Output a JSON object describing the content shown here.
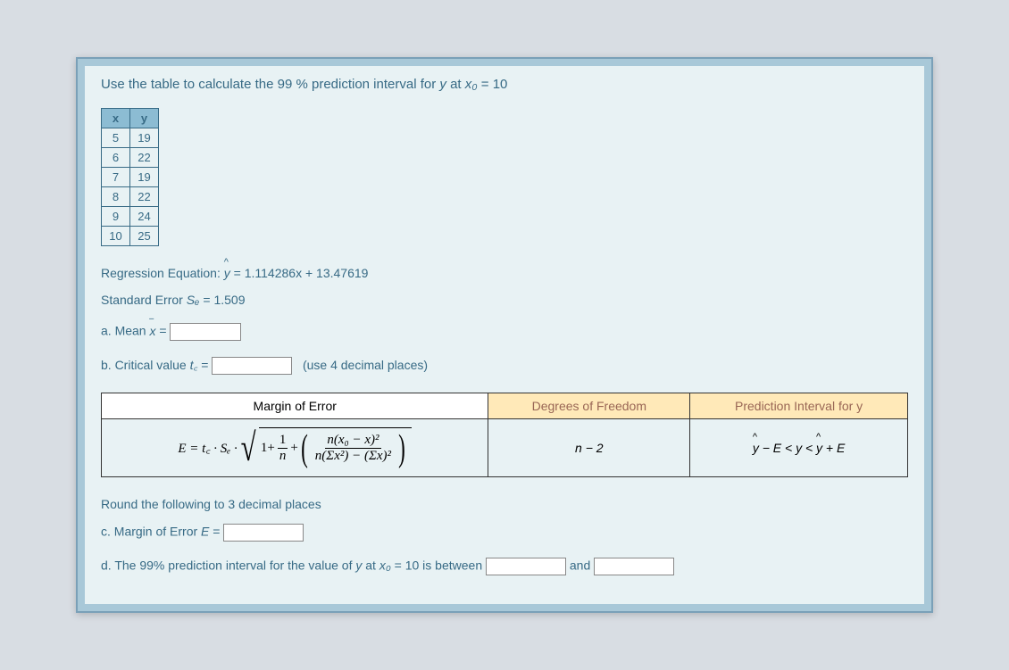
{
  "question": {
    "title_prefix": "Use the table to calculate the 99 % prediction interval for ",
    "y": "y",
    "at": " at ",
    "x0": "x₀",
    "equals": " = ",
    "value": "10"
  },
  "table": {
    "headers": [
      "x",
      "y"
    ],
    "rows": [
      [
        "5",
        "19"
      ],
      [
        "6",
        "22"
      ],
      [
        "7",
        "19"
      ],
      [
        "8",
        "22"
      ],
      [
        "9",
        "24"
      ],
      [
        "10",
        "25"
      ]
    ]
  },
  "regression": {
    "label": "Regression Equation: ",
    "yhat": "y",
    "eq": " = 1.114286x + 13.47619"
  },
  "standard_error": {
    "label": "Standard Error ",
    "symbol": "Sₑ",
    "eq": " = ",
    "value": "1.509"
  },
  "parts": {
    "a_label": "a. Mean ",
    "a_symbol": "x",
    "a_eq": " = ",
    "b_label": "b. Critical value ",
    "b_symbol": "t꜀",
    "b_eq": " = ",
    "b_hint": "(use 4 decimal places)",
    "round_hint": "Round the following to 3 decimal places",
    "c_label": "c. Margin of Error ",
    "c_symbol": "E",
    "c_eq": " = ",
    "d_text_prefix": "d. The 99% prediction interval for the value of ",
    "d_y": "y",
    "d_at": " at ",
    "d_x0": "x₀",
    "d_eq": " = ",
    "d_val": "10",
    "d_is": " is between ",
    "d_and": " and "
  },
  "formula_table": {
    "h1": "Margin of Error",
    "h2": "Degrees of Freedom",
    "h3": "Prediction Interval for y",
    "margin_lhs": "E = t꜀ · Sₑ · ",
    "one": "1",
    "plus": " + ",
    "frac1_num": "1",
    "frac1_den": "n",
    "frac2_num_a": "n(x₀ − ",
    "frac2_num_b": ")²",
    "frac2_den": "n(Σx²) − (Σx)²",
    "dof": "n − 2",
    "pred_a": " − E < y < ",
    "pred_b": " + E"
  }
}
